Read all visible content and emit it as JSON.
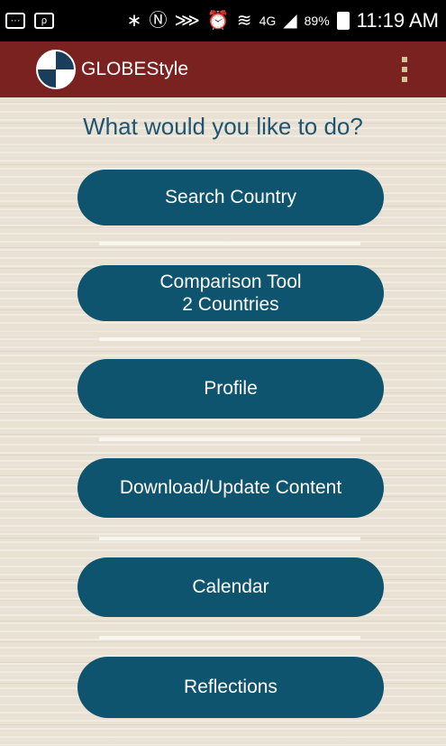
{
  "status_bar": {
    "battery": "89%",
    "time": "11:19 AM",
    "network": "4G",
    "icons": [
      "message-icon",
      "cast-icon",
      "bluetooth-icon",
      "nfc-icon",
      "mute-icon",
      "alarm-icon",
      "wifi-icon",
      "signal-icon",
      "battery-icon"
    ]
  },
  "app_bar": {
    "title": "GLOBEStyle",
    "logo_icon": "globe-logo-icon",
    "menu_icon": "overflow-menu-icon"
  },
  "main": {
    "prompt": "What would you like to do?",
    "buttons": [
      {
        "lines": [
          "Search Country"
        ]
      },
      {
        "lines": [
          "Comparison Tool",
          "2 Countries"
        ]
      },
      {
        "lines": [
          "Profile"
        ]
      },
      {
        "lines": [
          "Download/Update Content"
        ]
      },
      {
        "lines": [
          "Calendar"
        ]
      },
      {
        "lines": [
          "Reflections"
        ]
      }
    ]
  },
  "colors": {
    "app_bar": "#7a2220",
    "button": "#0f546e",
    "prompt_text": "#1f5570",
    "background": "#e9e1d3"
  }
}
